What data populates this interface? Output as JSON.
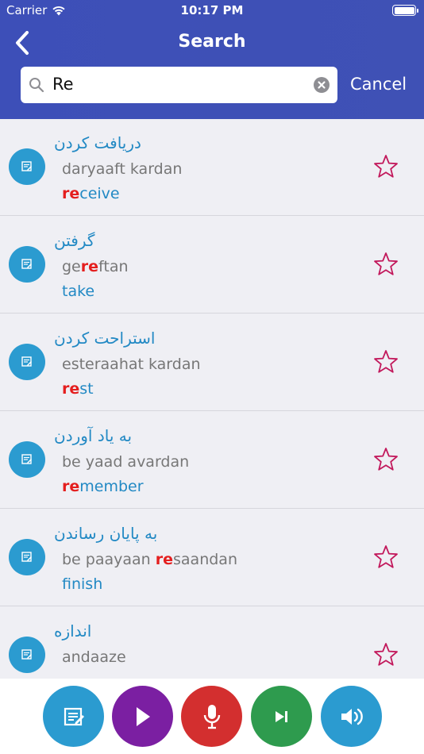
{
  "status": {
    "carrier": "Carrier",
    "time": "10:17 PM"
  },
  "nav": {
    "title": "Search"
  },
  "search": {
    "value": "Re",
    "cancel_label": "Cancel"
  },
  "results": [
    {
      "persian": "دریافت کردن",
      "translit": [
        "",
        "",
        "daryaaft kardan"
      ],
      "english": [
        "",
        "re",
        "ceive"
      ]
    },
    {
      "persian": "گرفتن",
      "translit": [
        "ge",
        "re",
        "ftan"
      ],
      "english": [
        "",
        "",
        "take"
      ]
    },
    {
      "persian": "استراحت کردن",
      "translit": [
        "",
        "",
        "esteraahat kardan"
      ],
      "english": [
        "",
        "re",
        "st"
      ]
    },
    {
      "persian": "به یاد آوردن",
      "translit": [
        "",
        "",
        "be yaad avardan"
      ],
      "english": [
        "",
        "re",
        "member"
      ]
    },
    {
      "persian": "به پایان رساندن",
      "translit": [
        "be paayaan ",
        "re",
        "saandan"
      ],
      "english": [
        "",
        "",
        "finish"
      ]
    },
    {
      "persian": "اندازه",
      "translit": [
        "",
        "",
        "andaaze"
      ],
      "english": [
        "",
        "",
        ""
      ]
    }
  ],
  "colors": {
    "header": "#3f51b5",
    "accent_blue": "#2289c4",
    "highlight_red": "#e41e1e",
    "star": "#c2185b",
    "btn_flashcard": "#2b9bd0",
    "btn_play": "#7b1fa2",
    "btn_mic": "#d32f2f",
    "btn_next": "#2e9b4e",
    "btn_speaker": "#2b9bd0"
  },
  "toolbar_icons": [
    "flashcard-icon",
    "play-icon",
    "microphone-icon",
    "skip-next-icon",
    "speaker-icon"
  ]
}
